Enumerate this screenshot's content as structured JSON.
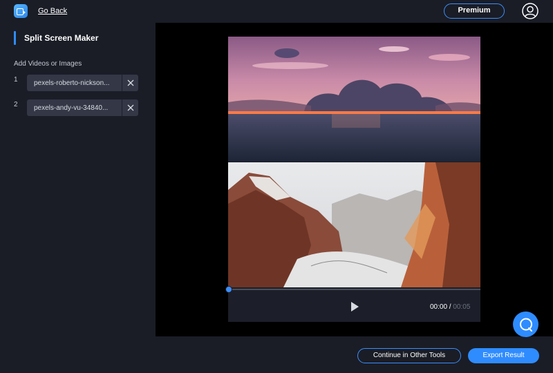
{
  "header": {
    "back_label": "Go Back",
    "premium_label": "Premium",
    "icons": {
      "app": "app-logo-icon",
      "user": "user-account-icon"
    }
  },
  "sidebar": {
    "title": "Split Screen Maker",
    "section_label": "Add Videos or Images",
    "items": [
      {
        "index": "1",
        "file_name": "pexels-roberto-nickson..."
      },
      {
        "index": "2",
        "file_name": "pexels-andy-vu-34840..."
      }
    ]
  },
  "player": {
    "current_time": "00:00",
    "separator": " / ",
    "total_time": "00:05",
    "progress": 0,
    "top_image": "sunset-over-sea",
    "bottom_image": "snowy-canyon-cliffs"
  },
  "footer": {
    "continue_label": "Continue in Other Tools",
    "export_label": "Export Result"
  },
  "colors": {
    "accent": "#2f8cff",
    "panel": "#1a1d26",
    "chip": "#333746"
  }
}
